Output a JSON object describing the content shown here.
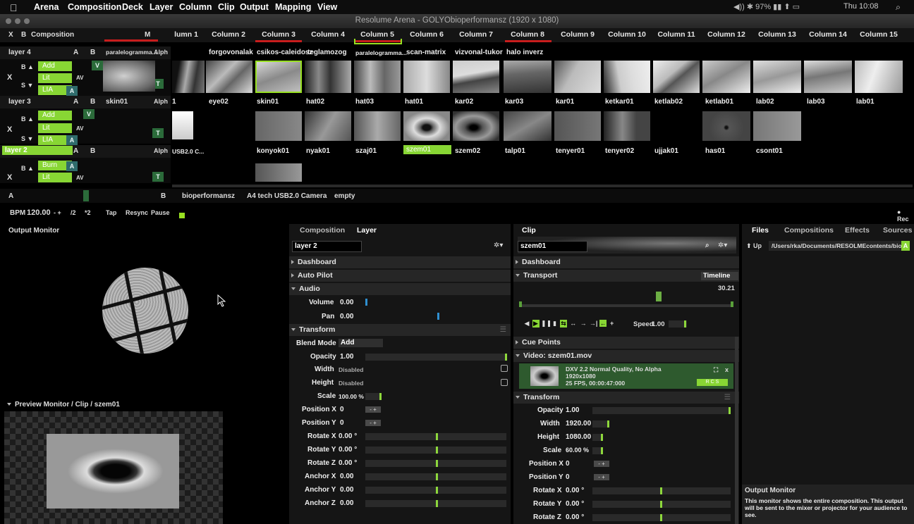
{
  "menubar": {
    "apple": "",
    "items": [
      "Arena",
      "Composition",
      "Deck",
      "Layer",
      "Column",
      "Clip",
      "Output",
      "Mapping",
      "View"
    ],
    "time": "Thu 10:08"
  },
  "window": {
    "title": "Resolume Arena - GOLYObioperformansz (1920 x 1080)"
  },
  "composition_header": {
    "x": "X",
    "b": "B",
    "label": "Composition",
    "m": "M"
  },
  "columns": [
    "lumn 1",
    "Column 2",
    "Column 3",
    "Column 4",
    "Column 5",
    "Column 6",
    "Column 7",
    "Column 8",
    "Column 9",
    "Column 10",
    "Column 11",
    "Column 12",
    "Column 13",
    "Column 14",
    "Column 15"
  ],
  "layers": [
    {
      "name": "layer 4",
      "a": "A",
      "b": "B",
      "alpha": "Alph",
      "clips": [
        "paralelogramma...",
        "",
        "forgovonalak",
        "csikos-caleidosz",
        "teglamozog",
        "paralelogramma...",
        "scan-matrix",
        "vizvonal-tukor",
        "halo inverz"
      ],
      "mode": "Add",
      "lit": "Lit",
      "lia": "LIA"
    },
    {
      "name": "layer 3",
      "a": "A",
      "b": "B",
      "alpha": "Alph",
      "clips": [
        "skin01",
        "1",
        "eye02",
        "skin01",
        "hat02",
        "hat03",
        "hat01",
        "kar02",
        "kar03",
        "kar01",
        "ketkar01",
        "ketlab02",
        "ketlab01",
        "lab02",
        "lab03",
        "lab01"
      ],
      "mode": "Add",
      "lit": "Lit",
      "lia": "LIA"
    },
    {
      "name": "layer 2",
      "a": "A",
      "b": "B",
      "alpha": "Alph",
      "clips": [
        "USB2.0 C...",
        "",
        "konyok01",
        "nyak01",
        "szaj01",
        "szem01",
        "szem02",
        "talp01",
        "tenyer01",
        "tenyer02",
        "ujjak01",
        "has01",
        "csont01"
      ],
      "mode": "Burn",
      "lit": "Lit"
    }
  ],
  "decks": {
    "a": "A",
    "b": "B",
    "items": [
      "bioperformansz",
      "A4 tech USB2.0 Camera",
      "empty"
    ]
  },
  "bpm": {
    "label": "BPM",
    "value": "120.00",
    "minus_plus": "- +",
    "div": "/2",
    "mul": "*2",
    "tap": "Tap",
    "resync": "Resync",
    "pause": "Pause"
  },
  "output_monitor": {
    "title": "Output Monitor"
  },
  "preview_monitor": {
    "title": "Preview Monitor / Clip / szem01"
  },
  "layer_panel": {
    "tabs": [
      "Composition",
      "Layer"
    ],
    "name": "layer 2",
    "sections": [
      "Dashboard",
      "Auto Pilot",
      "Audio",
      "Transform"
    ],
    "audio": [
      {
        "label": "Volume",
        "value": "0.00"
      },
      {
        "label": "Pan",
        "value": "0.00"
      }
    ],
    "blend_label": "Blend Mode",
    "blend_value": "Add",
    "transform": [
      {
        "label": "Opacity",
        "value": "1.00"
      },
      {
        "label": "Width",
        "value": "Disabled"
      },
      {
        "label": "Height",
        "value": "Disabled"
      },
      {
        "label": "Scale",
        "value": "100.00 %"
      },
      {
        "label": "Position X",
        "value": "0"
      },
      {
        "label": "Position Y",
        "value": "0"
      },
      {
        "label": "Rotate X",
        "value": "0.00 °"
      },
      {
        "label": "Rotate Y",
        "value": "0.00 °"
      },
      {
        "label": "Rotate Z",
        "value": "0.00 °"
      },
      {
        "label": "Anchor X",
        "value": "0.00"
      },
      {
        "label": "Anchor Y",
        "value": "0.00"
      },
      {
        "label": "Anchor Z",
        "value": "0.00"
      }
    ]
  },
  "clip_panel": {
    "tab": "Clip",
    "name": "szem01",
    "sections": [
      "Dashboard",
      "Transport",
      "Cue Points",
      "Video: szem01.mov",
      "Transform"
    ],
    "timeline": "Timeline",
    "time": "30.21",
    "speed_label": "Speed",
    "speed_value": "1.00",
    "video_info": [
      "DXV 2.2 Normal Quality, No Alpha",
      "1920x1080",
      "25 FPS, 00:00:47:000"
    ],
    "rcs": "R C S",
    "transform": [
      {
        "label": "Opacity",
        "value": "1.00"
      },
      {
        "label": "Width",
        "value": "1920.00"
      },
      {
        "label": "Height",
        "value": "1080.00"
      },
      {
        "label": "Scale",
        "value": "60.00 %"
      },
      {
        "label": "Position X",
        "value": "0"
      },
      {
        "label": "Position Y",
        "value": "0"
      },
      {
        "label": "Rotate X",
        "value": "0.00 °"
      },
      {
        "label": "Rotate Y",
        "value": "0.00 °"
      },
      {
        "label": "Rotate Z",
        "value": "0.00 °"
      }
    ]
  },
  "files_panel": {
    "tabs": [
      "Files",
      "Compositions",
      "Effects",
      "Sources"
    ],
    "up": "Up",
    "path": "/Users/rka/Documents/RESOLMEcontents/biofeedb...",
    "rec": "Rec"
  },
  "help": {
    "title": "Output Monitor",
    "text": "This monitor shows the entire composition. This output will be sent to the mixer or projector for your audience to see."
  },
  "colors": {
    "accent_green": "#98e021",
    "red_marker": "#c81d1d",
    "teal": "#2f6c6c"
  }
}
